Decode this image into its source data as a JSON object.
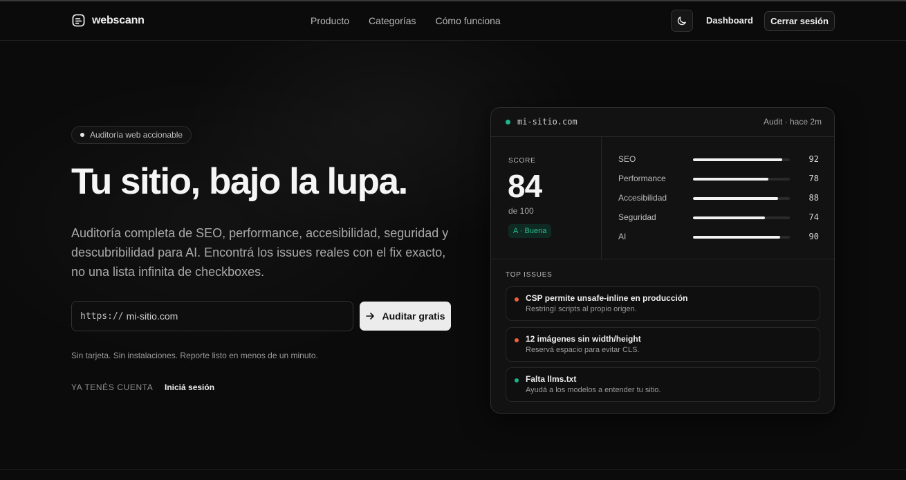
{
  "header": {
    "brand": "webscann",
    "nav": [
      "Producto",
      "Categorías",
      "Cómo funciona"
    ],
    "dashboard": "Dashboard",
    "logout": "Cerrar sesión",
    "theme_icon": "moon-icon"
  },
  "hero": {
    "badge": "Auditoría web accionable",
    "title": "Tu sitio, bajo la lupa.",
    "lede": "Auditoría completa de SEO, performance, accesibilidad, seguridad y descubribilidad para AI. Encontrá los issues reales con el fix exacto, no una lista infinita de checkboxes.",
    "url_prefix": "https://",
    "url_placeholder": "mi-sitio.com",
    "cta": "Auditar gratis",
    "fine_print": "Sin tarjeta. Sin instalaciones. Reporte listo en menos de un minuto.",
    "account_label": "YA TENÉS CUENTA",
    "login_link": "Iniciá sesión"
  },
  "audit_card": {
    "site": "mi-sitio.com",
    "time": "Audit · hace 2m",
    "score_label": "SCORE",
    "score": "84",
    "score_of": "de 100",
    "grade": "A · Buena",
    "metrics": [
      {
        "name": "SEO",
        "value": 92
      },
      {
        "name": "Performance",
        "value": 78
      },
      {
        "name": "Accesibilidad",
        "value": 88
      },
      {
        "name": "Seguridad",
        "value": 74
      },
      {
        "name": "AI",
        "value": 90
      }
    ],
    "issues_title": "TOP ISSUES",
    "issues": [
      {
        "title": "CSP permite unsafe-inline en producción",
        "desc": "Restringí scripts al propio origen.",
        "color": "#f0623a"
      },
      {
        "title": "12 imágenes sin width/height",
        "desc": "Reservá espacio para evitar CLS.",
        "color": "#f0623a"
      },
      {
        "title": "Falta llms.txt",
        "desc": "Ayudá a los modelos a entender tu sitio.",
        "color": "#1fb48a"
      }
    ]
  },
  "colors": {
    "accent_green": "#1fb48a",
    "issue_orange": "#f0623a",
    "background": "#0b0b0b"
  }
}
